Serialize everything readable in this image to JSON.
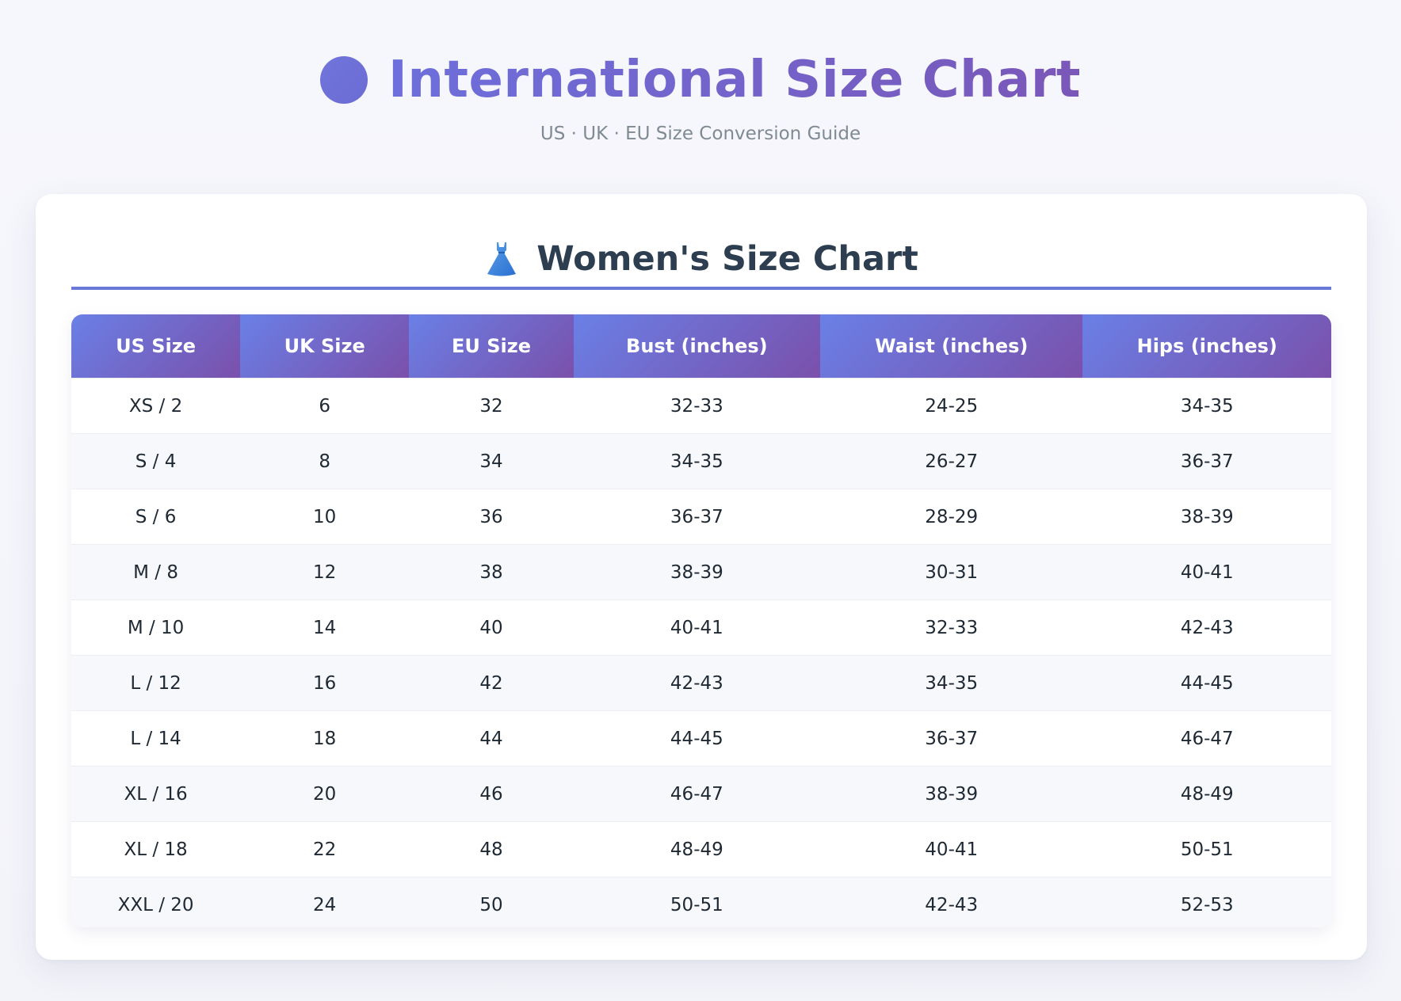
{
  "header": {
    "title": "International Size Chart",
    "subtitle": "US · UK · EU Size Conversion Guide"
  },
  "section": {
    "icon": "dress-icon",
    "title": "Women's Size Chart"
  },
  "table": {
    "columns": [
      "US Size",
      "UK Size",
      "EU Size",
      "Bust (inches)",
      "Waist (inches)",
      "Hips (inches)"
    ],
    "rows": [
      [
        "XS / 2",
        "6",
        "32",
        "32-33",
        "24-25",
        "34-35"
      ],
      [
        "S / 4",
        "8",
        "34",
        "34-35",
        "26-27",
        "36-37"
      ],
      [
        "S / 6",
        "10",
        "36",
        "36-37",
        "28-29",
        "38-39"
      ],
      [
        "M / 8",
        "12",
        "38",
        "38-39",
        "30-31",
        "40-41"
      ],
      [
        "M / 10",
        "14",
        "40",
        "40-41",
        "32-33",
        "42-43"
      ],
      [
        "L / 12",
        "16",
        "42",
        "42-43",
        "34-35",
        "44-45"
      ],
      [
        "L / 14",
        "18",
        "44",
        "44-45",
        "36-37",
        "46-47"
      ],
      [
        "XL / 16",
        "20",
        "46",
        "46-47",
        "38-39",
        "48-49"
      ],
      [
        "XL / 18",
        "22",
        "48",
        "48-49",
        "40-41",
        "50-51"
      ],
      [
        "XXL / 20",
        "24",
        "50",
        "50-51",
        "42-43",
        "52-53"
      ]
    ]
  },
  "colors": {
    "accent": "#6a78d8",
    "header_gradient_start": "#6a80e6",
    "header_gradient_end": "#7a50ab",
    "title": "#6e62c9",
    "section_title": "#2c3e50"
  }
}
